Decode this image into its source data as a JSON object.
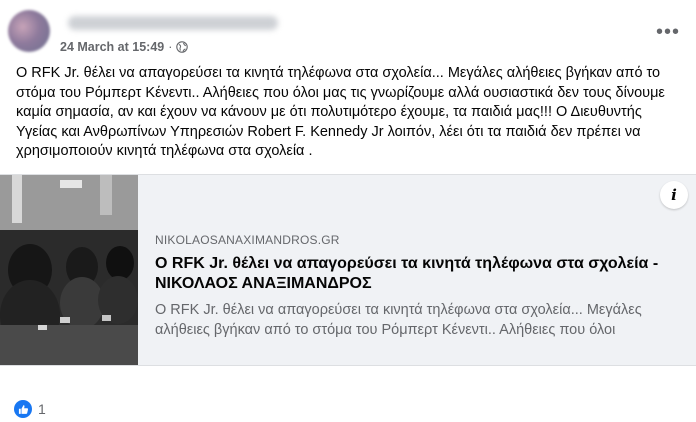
{
  "header": {
    "timestamp": "24 March at 15:49",
    "separator": "·",
    "privacy_icon": "globe-icon",
    "more_icon": "more-options-icon",
    "more_label": "•••"
  },
  "post": {
    "text": "Ο RFK Jr. θέλει να απαγορεύσει τα κινητά τηλέφωνα στα σχολεία... Μεγάλες αλήθειες βγήκαν από το στόμα του Ρόμπερτ Κένεντι.. Αλήθειες που όλοι μας τις γνωρίζουμε αλλά ουσιαστικά δεν τους δίνουμε καμία σημασία, αν και έχουν να κάνουν με ότι πολυτιμότερο έχουμε, τα παιδιά μας!!! Ο Διευθυντής Υγείας και Ανθρωπίνων Υπηρεσιών Robert F. Kennedy Jr λοιπόν, λέει ότι τα παιδιά δεν πρέπει να χρησιμοποιούν κινητά τηλέφωνα στα σχολεία ."
  },
  "link_card": {
    "domain": "NIKOLAOSANAXIMANDROS.GR",
    "title": "Ο RFK Jr. θέλει να απαγορεύσει τα κινητά τηλέφωνα στα σχολεία - ΝΙΚΟΛΑΟΣ ΑΝΑΞΙΜΑΝΔΡΟΣ",
    "description": "Ο RFK Jr. θέλει να απαγορεύσει τα κινητά τηλέφωνα στα σχολεία... Μεγάλες αλήθειες βγήκαν από το στόμα του Ρόμπερτ Κένεντι.. Αλήθειες που όλοι",
    "info_label": "i",
    "image_subject": "students-using-phones-in-classroom"
  },
  "reactions": {
    "icon": "like-icon",
    "count": "1",
    "colors": {
      "like": "#1877f2"
    }
  }
}
